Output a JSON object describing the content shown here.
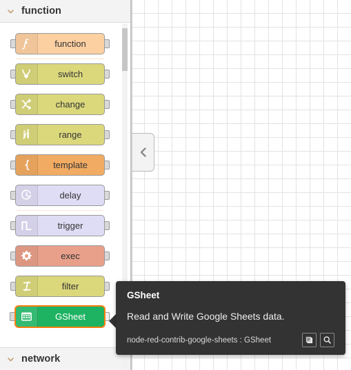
{
  "palette": {
    "sections": [
      {
        "name": "function",
        "label": "function",
        "chevron_icon": "chevron-down-icon",
        "expanded": true
      },
      {
        "name": "network",
        "label": "network",
        "chevron_icon": "chevron-down-icon",
        "expanded": true
      }
    ],
    "nodes": [
      {
        "label": "function",
        "icon": "function-f-icon",
        "color": "#fdd0a2",
        "selected": false,
        "sep_after": true
      },
      {
        "label": "switch",
        "icon": "switch-arrows-icon",
        "color": "#dbd87c",
        "selected": false,
        "sep_after": false
      },
      {
        "label": "change",
        "icon": "change-swap-icon",
        "color": "#dbd87c",
        "selected": false,
        "sep_after": false
      },
      {
        "label": "range",
        "icon": "range-bars-icon",
        "color": "#dbd87c",
        "selected": false,
        "sep_after": false
      },
      {
        "label": "template",
        "icon": "template-brace-icon",
        "color": "#f2ab63",
        "selected": false,
        "sep_after": false
      },
      {
        "label": "delay",
        "icon": "delay-clock-icon",
        "color": "#dfdcf5",
        "selected": false,
        "sep_after": true
      },
      {
        "label": "trigger",
        "icon": "trigger-pulse-icon",
        "color": "#dfdcf5",
        "selected": false,
        "sep_after": false
      },
      {
        "label": "exec",
        "icon": "exec-gear-icon",
        "color": "#e8a08a",
        "selected": false,
        "sep_after": false
      },
      {
        "label": "filter",
        "icon": "filter-rbe-icon",
        "color": "#dbd87c",
        "selected": false,
        "sep_after": false
      },
      {
        "label": "GSheet",
        "icon": "spreadsheet-grid-icon",
        "color": "#1eb362",
        "selected": true,
        "sep_after": false
      }
    ],
    "scrollbar": {
      "name": "palette-scrollbar"
    }
  },
  "collapse_handle": {
    "icon": "chevron-left-icon",
    "name": "palette-collapse-handle"
  },
  "tooltip": {
    "title": "GSheet",
    "description": "Read and Write Google Sheets data.",
    "module": "node-red-contrib-google-sheets : GSheet",
    "buttons": [
      {
        "icon": "book-docs-icon",
        "name": "open-node-help-button"
      },
      {
        "icon": "search-icon",
        "name": "search-node-button"
      }
    ]
  },
  "canvas": {
    "name": "flow-canvas",
    "grid": "20px"
  },
  "colors": {
    "selection": "#ff7f0e",
    "tooltip_bg": "#333333",
    "header_bg": "#f3f3f3",
    "grid_line": "#e3e3e3"
  }
}
